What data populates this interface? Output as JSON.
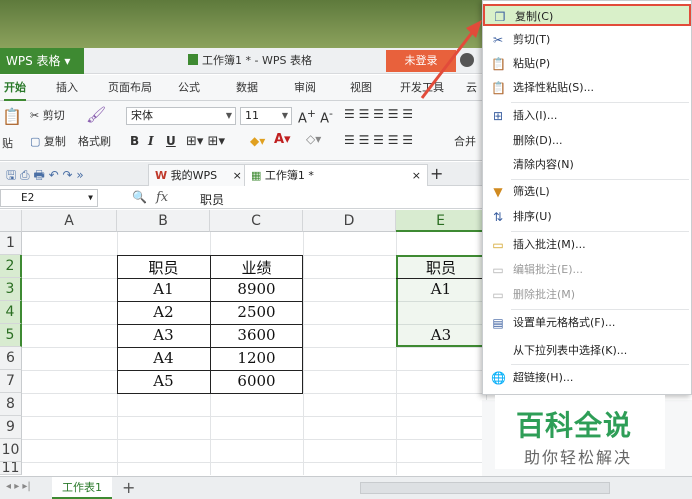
{
  "app": {
    "name": "WPS 表格",
    "doc_title": "工作簿1 * - WPS 表格",
    "login": "未登录"
  },
  "ribbon_tabs": [
    "开始",
    "插入",
    "页面布局",
    "公式",
    "数据",
    "审阅",
    "视图",
    "开发工具",
    "云"
  ],
  "ribbon": {
    "cut": "剪切",
    "paste": "贴",
    "copy": "复制",
    "format_painter": "格式刷",
    "font_name": "宋体",
    "font_size": "11",
    "bold": "B",
    "italic": "I",
    "underline": "U",
    "merge": "合并"
  },
  "doc_tabs": {
    "wps": "我的WPS",
    "book": "工作簿1 *"
  },
  "formula_bar": {
    "cell_ref": "E2",
    "fx": "fx",
    "value": "职员"
  },
  "columns": [
    "A",
    "B",
    "C",
    "D",
    "E"
  ],
  "rows": [
    "1",
    "2",
    "3",
    "4",
    "5",
    "6",
    "7",
    "8",
    "9",
    "10",
    "11"
  ],
  "table": {
    "headers": [
      "职员",
      "业绩"
    ],
    "rows": [
      [
        "A1",
        "8900"
      ],
      [
        "A2",
        "2500"
      ],
      [
        "A3",
        "3600"
      ],
      [
        "A4",
        "1200"
      ],
      [
        "A5",
        "6000"
      ]
    ]
  },
  "selection_e": [
    "职员",
    "A1",
    "",
    "A3"
  ],
  "sheet_tab": "工作表1",
  "context_menu": [
    {
      "label": "复制(C)",
      "icon": "copy-icon",
      "highlighted": true
    },
    {
      "label": "剪切(T)",
      "icon": "scissors-icon"
    },
    {
      "label": "粘贴(P)",
      "icon": "paste-icon"
    },
    {
      "label": "选择性粘贴(S)...",
      "icon": "paste-special-icon"
    },
    {
      "label": "插入(I)...",
      "icon": "insert-icon"
    },
    {
      "label": "删除(D)...",
      "icon": ""
    },
    {
      "label": "清除内容(N)",
      "icon": ""
    },
    {
      "label": "筛选(L)",
      "icon": "filter-icon"
    },
    {
      "label": "排序(U)",
      "icon": "sort-icon"
    },
    {
      "label": "插入批注(M)...",
      "icon": "comment-insert-icon"
    },
    {
      "label": "编辑批注(E)...",
      "icon": "comment-edit-icon",
      "disabled": true
    },
    {
      "label": "删除批注(M)",
      "icon": "comment-delete-icon",
      "disabled": true
    },
    {
      "label": "设置单元格格式(F)...",
      "icon": "format-cells-icon"
    },
    {
      "label": "从下拉列表中选择(K)...",
      "icon": ""
    },
    {
      "label": "超链接(H)...",
      "icon": "hyperlink-icon"
    }
  ],
  "watermark": {
    "title": "百科全说",
    "subtitle": "助你轻松解决"
  },
  "colors": {
    "accent": "#3e8a32",
    "highlight_border": "#e24b3a",
    "login": "#e8613c"
  }
}
